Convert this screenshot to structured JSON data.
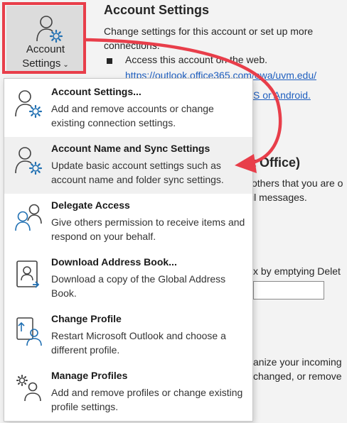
{
  "tile": {
    "line1": "Account",
    "line2": "Settings",
    "chevron": "⌄",
    "icon": "person-gear-icon"
  },
  "background": {
    "title": "Account Settings",
    "description": "Change settings for this account or set up more connections.",
    "bullet_text": "Access this account on the web.",
    "link_text": "https://outlook.office365.com/owa/uvm.edu/",
    "link2_text": "S or Android.",
    "heading2": "t Office)",
    "fragments": [
      "others that you are o",
      "il messages.",
      "x by emptying Delet",
      "anize your incoming",
      "changed, or remove"
    ]
  },
  "menu": {
    "items": [
      {
        "title": "Account Settings...",
        "desc": "Add and remove accounts or change existing connection settings.",
        "icon": "person-gear-icon"
      },
      {
        "title": "Account Name and Sync Settings",
        "desc": "Update basic account settings such as account name and folder sync settings.",
        "icon": "person-gear-icon"
      },
      {
        "title": "Delegate Access",
        "desc": "Give others permission to receive items and respond on your behalf.",
        "icon": "people-icon"
      },
      {
        "title": "Download Address Book...",
        "desc": "Download a copy of the Global Address Book.",
        "icon": "address-book-icon"
      },
      {
        "title": "Change Profile",
        "desc": "Restart Microsoft Outlook and choose a different profile.",
        "icon": "change-profile-icon"
      },
      {
        "title": "Manage Profiles",
        "desc": "Add and remove profiles or change existing profile settings.",
        "icon": "manage-profiles-icon"
      }
    ]
  },
  "colors": {
    "annotation_red": "#e83e4a",
    "icon_blue": "#1f6fb2",
    "link_blue": "#1f5fbf"
  }
}
